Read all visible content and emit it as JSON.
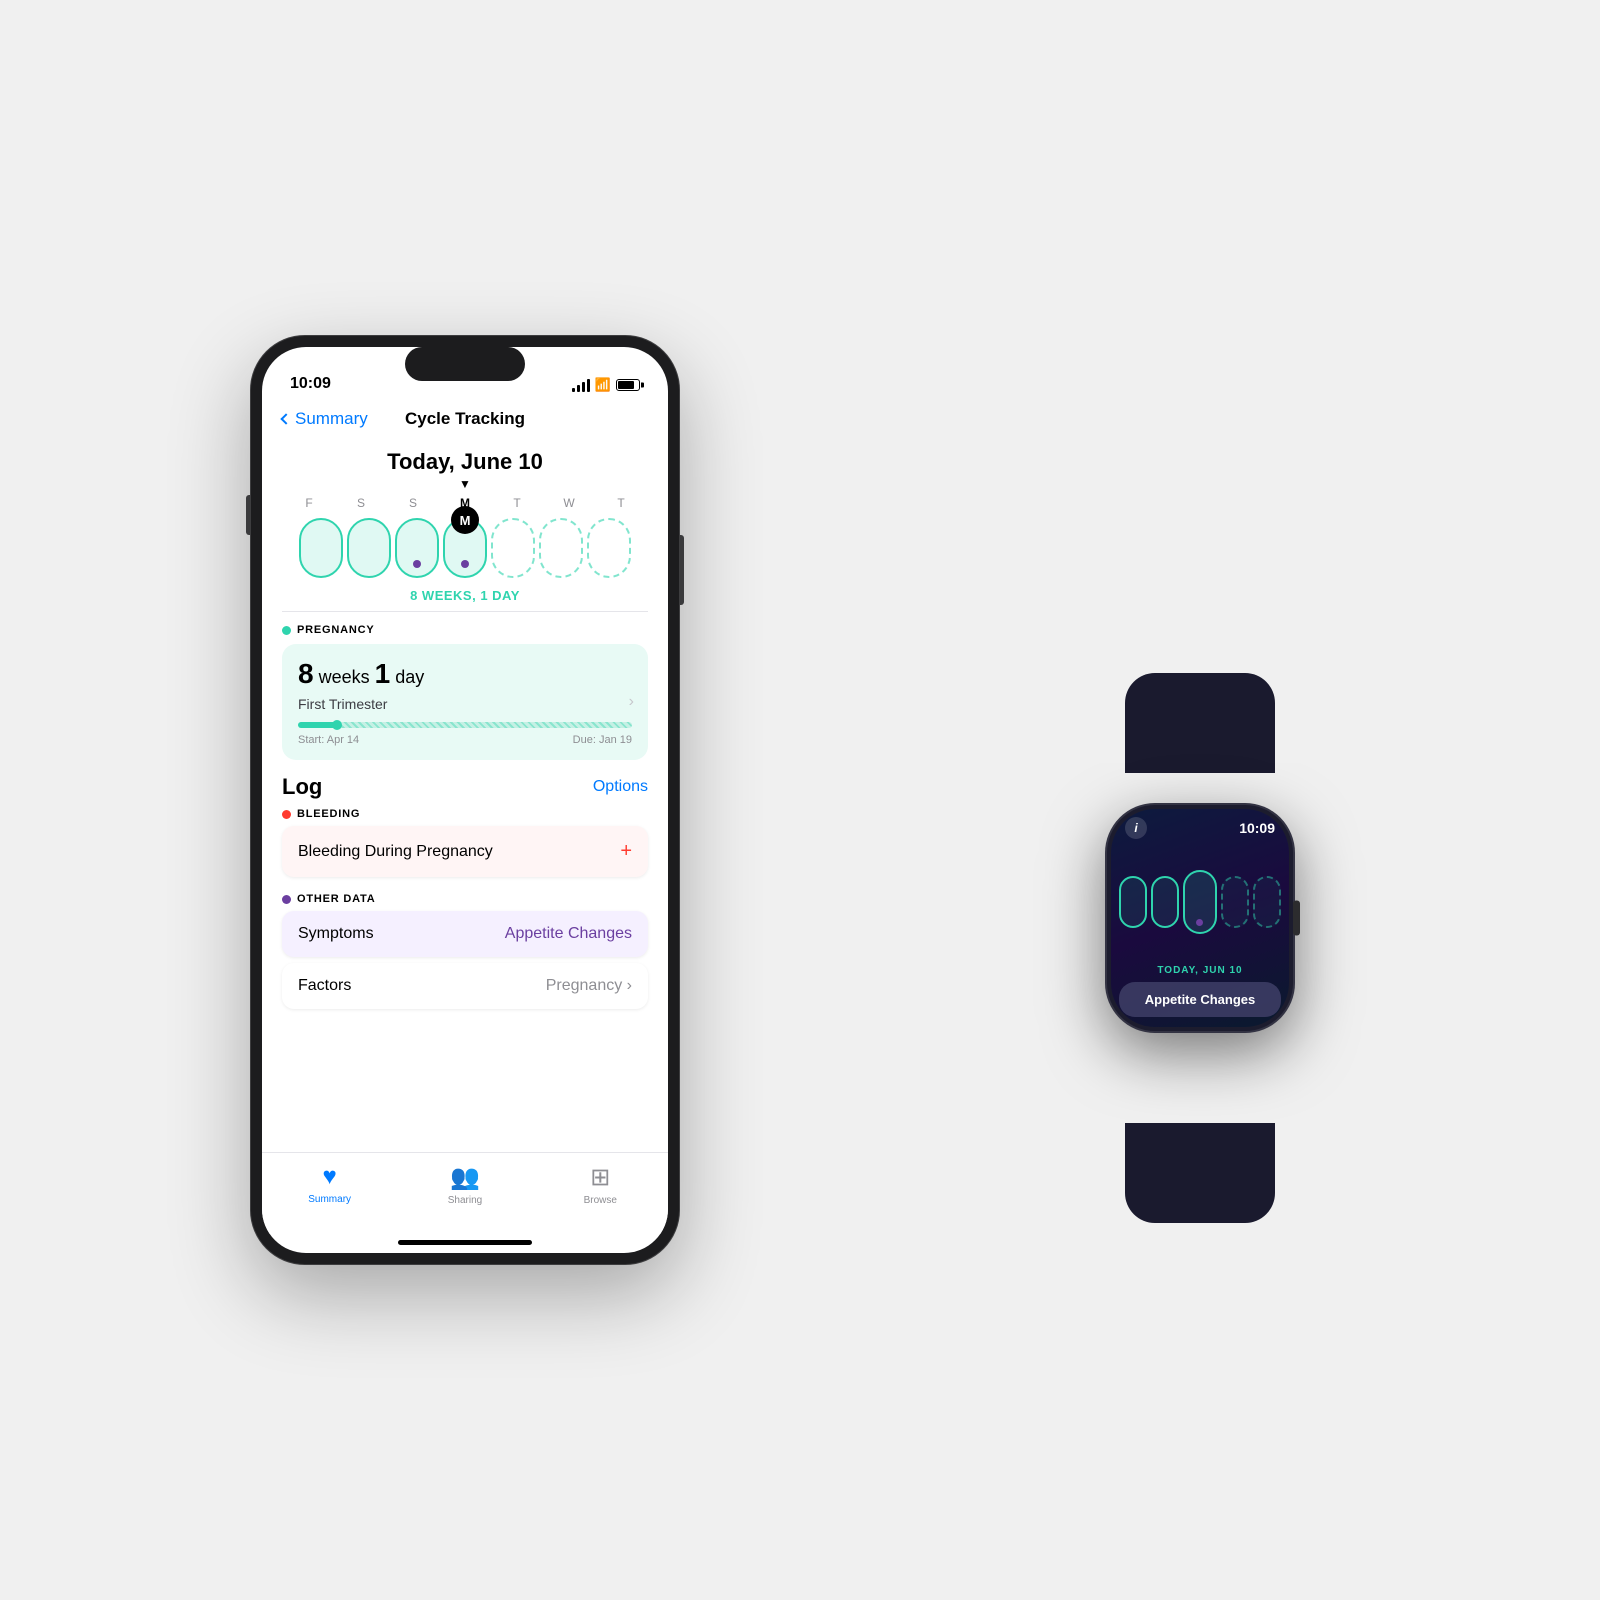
{
  "background": "#f0f0f0",
  "iphone": {
    "status_bar": {
      "time": "10:09"
    },
    "nav": {
      "back_label": "Summary",
      "title": "Cycle Tracking"
    },
    "date_header": "Today, June 10",
    "week_days": [
      "F",
      "S",
      "S",
      "M",
      "T",
      "W",
      "T"
    ],
    "weeks_label": "8 WEEKS, 1 DAY",
    "pregnancy_section": {
      "section_label": "PREGNANCY",
      "weeks_num": "8",
      "weeks_word": " weeks ",
      "days_num": "1",
      "days_word": " day",
      "trimester": "First Trimester",
      "start_label": "Start: Apr 14",
      "due_label": "Due: Jan 19"
    },
    "log": {
      "title": "Log",
      "options_label": "Options",
      "bleeding_section_label": "BLEEDING",
      "bleeding_item": "Bleeding During Pregnancy",
      "other_section_label": "OTHER DATA",
      "symptoms_label": "Symptoms",
      "symptoms_value": "Appetite Changes",
      "factors_label": "Factors",
      "factors_value": "Pregnancy"
    },
    "tab_bar": {
      "summary_label": "Summary",
      "sharing_label": "Sharing",
      "browse_label": "Browse"
    }
  },
  "watch": {
    "time": "10:09",
    "info_btn": "i",
    "date_label": "TODAY, JUN 10",
    "notification_text": "Appetite Changes"
  }
}
